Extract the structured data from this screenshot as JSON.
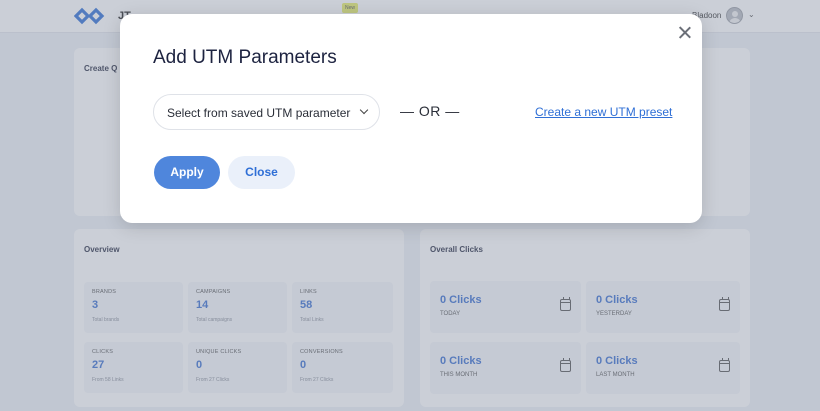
{
  "header": {
    "app_initials": "JT",
    "sticker": "New",
    "user_name": "Bladoon"
  },
  "dashboard": {
    "create_panel_title": "Create Q",
    "overview": {
      "title": "Overview",
      "cards": [
        {
          "label": "BRANDS",
          "value": "3",
          "sub": "Total brands"
        },
        {
          "label": "CAMPAIGNS",
          "value": "14",
          "sub": "Total campaigns"
        },
        {
          "label": "LINKS",
          "value": "58",
          "sub": "Total Links"
        },
        {
          "label": "CLICKS",
          "value": "27",
          "sub": "From 58 Links"
        },
        {
          "label": "UNIQUE CLICKS",
          "value": "0",
          "sub": "From 27 Clicks"
        },
        {
          "label": "CONVERSIONS",
          "value": "0",
          "sub": "From 27 Clicks"
        }
      ]
    },
    "overall_clicks": {
      "title": "Overall Clicks",
      "cards": [
        {
          "value": "0 Clicks",
          "label": "TODAY"
        },
        {
          "value": "0 Clicks",
          "label": "YESTERDAY"
        },
        {
          "value": "0 Clicks",
          "label": "THIS MONTH"
        },
        {
          "value": "0 Clicks",
          "label": "LAST MONTH"
        }
      ]
    }
  },
  "modal": {
    "title": "Add UTM Parameters",
    "select_placeholder": "Select from saved UTM parameter",
    "or_text": "— OR —",
    "create_link": "Create a new UTM preset",
    "apply_label": "Apply",
    "close_label": "Close"
  },
  "colors": {
    "accent": "#4f86dc",
    "link": "#2f6fd6",
    "value": "#3a6fd1"
  },
  "icons": {
    "logo": "diamond-logo-icon",
    "close": "close-icon",
    "chevron": "chevron-down-icon",
    "calendar": "calendar-icon"
  }
}
